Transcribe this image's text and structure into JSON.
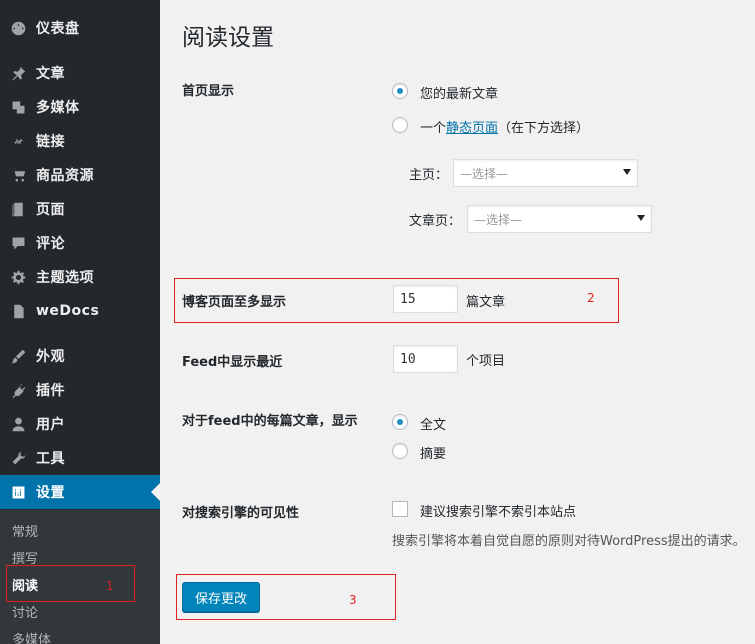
{
  "sidebar": {
    "items": [
      {
        "label": "仪表盘",
        "icon": "dashboard-icon"
      },
      {
        "label": "文章",
        "icon": "pushpin-icon"
      },
      {
        "label": "多媒体",
        "icon": "media-icon"
      },
      {
        "label": "链接",
        "icon": "link-icon"
      },
      {
        "label": "商品资源",
        "icon": "cart-icon"
      },
      {
        "label": "页面",
        "icon": "page-icon"
      },
      {
        "label": "评论",
        "icon": "comment-icon"
      },
      {
        "label": "主题选项",
        "icon": "gear-icon"
      },
      {
        "label": "weDocs",
        "icon": "document-icon"
      },
      {
        "label": "外观",
        "icon": "brush-icon"
      },
      {
        "label": "插件",
        "icon": "plugin-icon"
      },
      {
        "label": "用户",
        "icon": "user-icon"
      },
      {
        "label": "工具",
        "icon": "wrench-icon"
      },
      {
        "label": "设置",
        "icon": "settings-icon"
      }
    ],
    "submenu": [
      "常规",
      "撰写",
      "阅读",
      "讨论",
      "多媒体"
    ],
    "active_item": "设置",
    "current_submenu": "阅读"
  },
  "page": {
    "title": "阅读设置",
    "front_page": {
      "label": "首页显示",
      "option_latest": "您的最新文章",
      "option_static_prefix": "一个",
      "option_static_link": "静态页面",
      "option_static_suffix": "（在下方选择）",
      "homepage_label": "主页：",
      "homepage_value": "—选择—",
      "postspage_label": "文章页：",
      "postspage_value": "—选择—"
    },
    "posts_per_page": {
      "label": "博客页面至多显示",
      "value": "15",
      "unit": "篇文章"
    },
    "feed_count": {
      "label": "Feed中显示最近",
      "value": "10",
      "unit": "个项目"
    },
    "feed_content": {
      "label": "对于feed中的每篇文章，显示",
      "option_full": "全文",
      "option_summary": "摘要"
    },
    "search_visibility": {
      "label": "对搜索引擎的可见性",
      "checkbox_label": "建议搜索引擎不索引本站点",
      "description": "搜索引擎将本着自觉自愿的原则对待WordPress提出的请求。"
    },
    "save_button": "保存更改"
  },
  "annotations": {
    "one": "1",
    "two": "2",
    "three": "3"
  },
  "colors": {
    "sidebar_bg": "#23282d",
    "active_bg": "#0073aa",
    "annotation": "#e02020",
    "button": "#0085ba"
  }
}
